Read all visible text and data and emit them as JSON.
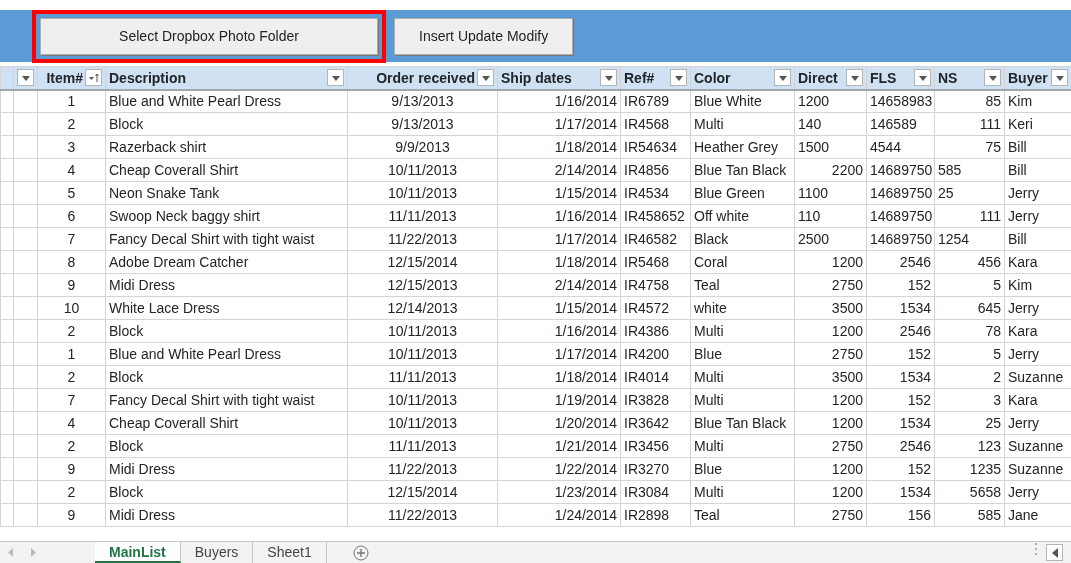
{
  "buttons": [
    {
      "label": "Select Dropbox Photo Folder",
      "highlighted": true
    },
    {
      "label": "Insert Update Modify",
      "highlighted": false
    }
  ],
  "table": {
    "columns": [
      {
        "label": "Item#",
        "sorted": true
      },
      {
        "label": "Description",
        "sorted": false
      },
      {
        "label": "Order received",
        "sorted": false
      },
      {
        "label": "Ship dates",
        "sorted": false
      },
      {
        "label": "Ref#",
        "sorted": false
      },
      {
        "label": "Color",
        "sorted": false
      },
      {
        "label": "Direct",
        "sorted": false
      },
      {
        "label": "FLS",
        "sorted": false
      },
      {
        "label": "NS",
        "sorted": false
      },
      {
        "label": "Buyer",
        "sorted": false
      }
    ],
    "rows": [
      {
        "cells": [
          "1",
          "Blue and White Pearl Dress",
          "9/13/2013",
          "1/16/2014",
          "IR6789",
          "Blue White",
          "1200",
          "14658983",
          "85",
          "Kim"
        ],
        "left": [
          true,
          true,
          false
        ]
      },
      {
        "cells": [
          "2",
          "Block",
          "9/13/2013",
          "1/17/2014",
          "IR4568",
          "Multi",
          "140",
          "146589",
          "111",
          "Keri"
        ],
        "left": [
          true,
          true,
          false
        ]
      },
      {
        "cells": [
          "3",
          "Razerback shirt",
          "9/9/2013",
          "1/18/2014",
          "IR54634",
          "Heather Grey",
          "1500",
          "4544",
          "75",
          "Bill"
        ],
        "left": [
          true,
          true,
          false
        ]
      },
      {
        "cells": [
          "4",
          "Cheap Coverall Shirt",
          "10/11/2013",
          "2/14/2014",
          "IR4856",
          "Blue Tan Black",
          "2200",
          "14689750",
          "585",
          "Bill"
        ],
        "left": [
          false,
          true,
          true
        ]
      },
      {
        "cells": [
          "5",
          "Neon Snake Tank",
          "10/11/2013",
          "1/15/2014",
          "IR4534",
          "Blue Green",
          "1100",
          "14689750",
          "25",
          "Jerry"
        ],
        "left": [
          true,
          true,
          true
        ]
      },
      {
        "cells": [
          "6",
          "Swoop Neck baggy shirt",
          "11/11/2013",
          "1/16/2014",
          "IR458652",
          "Off white",
          "110",
          "14689750",
          "111",
          "Jerry"
        ],
        "left": [
          true,
          true,
          false
        ]
      },
      {
        "cells": [
          "7",
          "Fancy Decal Shirt with tight waist",
          "11/22/2013",
          "1/17/2014",
          "IR46582",
          "Black",
          "2500",
          "14689750",
          "1254",
          "Bill"
        ],
        "left": [
          true,
          true,
          true
        ]
      },
      {
        "cells": [
          "8",
          "Adobe Dream Catcher",
          "12/15/2014",
          "1/18/2014",
          "IR5468",
          "Coral",
          "1200",
          "2546",
          "456",
          "Kara"
        ],
        "left": [
          false,
          false,
          false
        ]
      },
      {
        "cells": [
          "9",
          "Midi Dress",
          "12/15/2013",
          "2/14/2014",
          "IR4758",
          "Teal",
          "2750",
          "152",
          "5",
          "Kim"
        ],
        "left": [
          false,
          false,
          false
        ]
      },
      {
        "cells": [
          "10",
          "White Lace Dress",
          "12/14/2013",
          "1/15/2014",
          "IR4572",
          "white",
          "3500",
          "1534",
          "645",
          "Jerry"
        ],
        "left": [
          false,
          false,
          false
        ]
      },
      {
        "cells": [
          "2",
          "Block",
          "10/11/2013",
          "1/16/2014",
          "IR4386",
          "Multi",
          "1200",
          "2546",
          "78",
          "Kara"
        ],
        "left": [
          false,
          false,
          false
        ]
      },
      {
        "cells": [
          "1",
          "Blue and White Pearl Dress",
          "10/11/2013",
          "1/17/2014",
          "IR4200",
          "Blue",
          "2750",
          "152",
          "5",
          "Jerry"
        ],
        "left": [
          false,
          false,
          false
        ]
      },
      {
        "cells": [
          "2",
          "Block",
          "11/11/2013",
          "1/18/2014",
          "IR4014",
          "Multi",
          "3500",
          "1534",
          "2",
          "Suzanne"
        ],
        "left": [
          false,
          false,
          false
        ]
      },
      {
        "cells": [
          "7",
          "Fancy Decal Shirt with tight waist",
          "10/11/2013",
          "1/19/2014",
          "IR3828",
          "Multi",
          "1200",
          "152",
          "3",
          "Kara"
        ],
        "left": [
          false,
          false,
          false
        ]
      },
      {
        "cells": [
          "4",
          "Cheap Coverall Shirt",
          "10/11/2013",
          "1/20/2014",
          "IR3642",
          "Blue Tan Black",
          "1200",
          "1534",
          "25",
          "Jerry"
        ],
        "left": [
          false,
          false,
          false
        ]
      },
      {
        "cells": [
          "2",
          "Block",
          "11/11/2013",
          "1/21/2014",
          "IR3456",
          "Multi",
          "2750",
          "2546",
          "123",
          "Suzanne"
        ],
        "left": [
          false,
          false,
          false
        ]
      },
      {
        "cells": [
          "9",
          "Midi Dress",
          "11/22/2013",
          "1/22/2014",
          "IR3270",
          "Blue",
          "1200",
          "152",
          "1235",
          "Suzanne"
        ],
        "left": [
          false,
          false,
          false
        ]
      },
      {
        "cells": [
          "2",
          "Block",
          "12/15/2014",
          "1/23/2014",
          "IR3084",
          "Multi",
          "1200",
          "1534",
          "5658",
          "Jerry"
        ],
        "left": [
          false,
          false,
          false
        ]
      },
      {
        "cells": [
          "9",
          "Midi Dress",
          "11/22/2013",
          "1/24/2014",
          "IR2898",
          "Teal",
          "2750",
          "156",
          "585",
          "Jane"
        ],
        "left": [
          false,
          false,
          false
        ]
      }
    ]
  },
  "sheet_tabs": [
    {
      "label": "MainList",
      "selected": true
    },
    {
      "label": "Buyers",
      "selected": false
    },
    {
      "label": "Sheet1",
      "selected": false
    }
  ]
}
